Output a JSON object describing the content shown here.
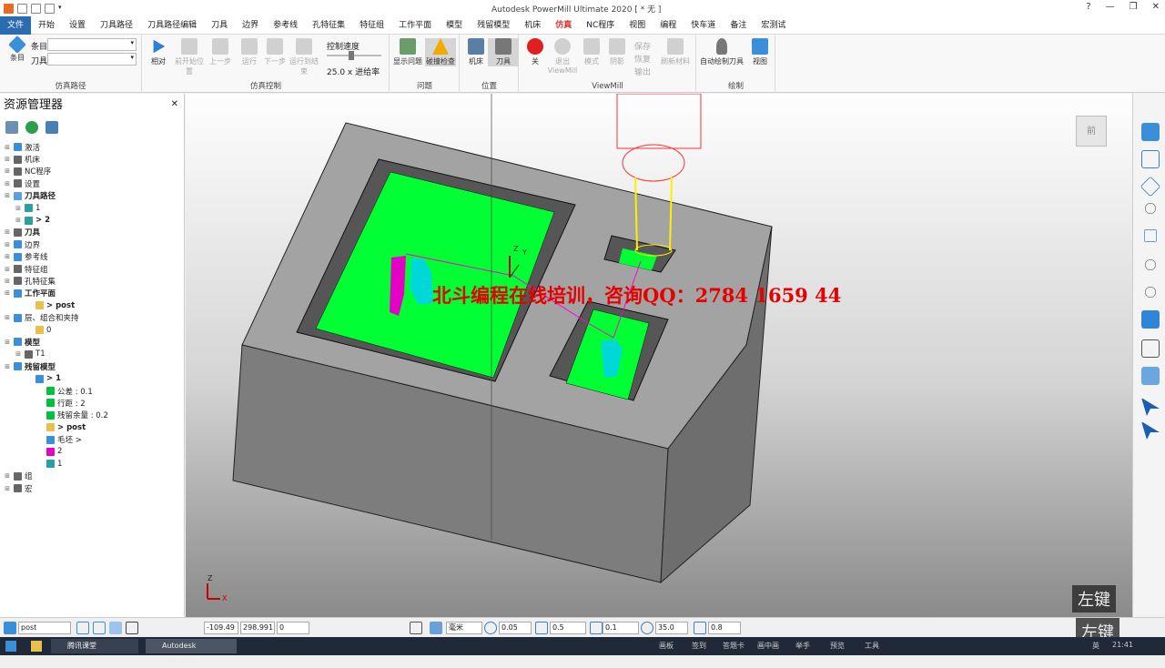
{
  "titlebar": {
    "title": "Autodesk PowerMill Ultimate 2020   [ * 无 ]",
    "help_icon": "help-icon"
  },
  "ribbon_tabs": [
    "文件",
    "开始",
    "设置",
    "刀具路径",
    "刀具路径编辑",
    "刀具",
    "边界",
    "参考线",
    "孔特征集",
    "特征组",
    "工作平面",
    "模型",
    "残留模型",
    "机床",
    "仿真",
    "NC程序",
    "视图",
    "编程",
    "快车道",
    "备注",
    "宏测试"
  ],
  "ribbon": {
    "toolpath_group": {
      "label": "仿真路径",
      "big_button": "条目",
      "item_label": "条目",
      "tool_label": "刀具"
    },
    "sim_control": {
      "label": "仿真控制",
      "buttons": [
        "相对",
        "前开始位置",
        "上一步",
        "运行",
        "下一步",
        "运行到结束"
      ],
      "speed_label": "控制速度",
      "speed_value": "25.0 x 进给率"
    },
    "issues": {
      "label": "问题",
      "buttons": [
        "显示问题",
        "碰撞检查"
      ]
    },
    "position": {
      "label": "位置",
      "buttons": [
        "机床",
        "刀具"
      ]
    },
    "viewmill": {
      "label": "ViewMill",
      "buttons": [
        "关",
        "退出 ViewMill",
        "模式",
        "阴影"
      ],
      "small": [
        "保存",
        "恢复",
        "输出",
        "刷新材料"
      ]
    },
    "draw": {
      "label": "绘制",
      "buttons": [
        "自动绘制刀具",
        "视图"
      ]
    }
  },
  "explorer": {
    "title": "资源管理器",
    "items": [
      {
        "label": "激活",
        "level": 0,
        "bold": false
      },
      {
        "label": "机床",
        "level": 0,
        "bold": false
      },
      {
        "label": "NC程序",
        "level": 0,
        "bold": false
      },
      {
        "label": "设置",
        "level": 0,
        "bold": false
      },
      {
        "label": "刀具路径",
        "level": 0,
        "bold": true
      },
      {
        "label": "1",
        "level": 1,
        "bold": false
      },
      {
        "label": "> 2",
        "level": 1,
        "bold": true
      },
      {
        "label": "刀具",
        "level": 0,
        "bold": true
      },
      {
        "label": "边界",
        "level": 0,
        "bold": false
      },
      {
        "label": "参考线",
        "level": 0,
        "bold": false
      },
      {
        "label": "特征组",
        "level": 0,
        "bold": false
      },
      {
        "label": "孔特征集",
        "level": 0,
        "bold": false
      },
      {
        "label": "工作平面",
        "level": 0,
        "bold": true
      },
      {
        "label": "> post",
        "level": 2,
        "bold": true
      },
      {
        "label": "层、组合和夹持",
        "level": 0,
        "bold": false
      },
      {
        "label": "0",
        "level": 2,
        "bold": false
      },
      {
        "label": "模型",
        "level": 0,
        "bold": true
      },
      {
        "label": "T1",
        "level": 1,
        "bold": false
      },
      {
        "label": "残留模型",
        "level": 0,
        "bold": true
      },
      {
        "label": "> 1",
        "level": 2,
        "bold": true
      },
      {
        "label": "公差 : 0.1",
        "level": 3,
        "bold": false
      },
      {
        "label": "行距 : 2",
        "level": 3,
        "bold": false
      },
      {
        "label": "残留余量 : 0.2",
        "level": 3,
        "bold": false
      },
      {
        "label": "> post",
        "level": 3,
        "bold": true
      },
      {
        "label": "毛坯 >",
        "level": 3,
        "bold": false
      },
      {
        "label": "2",
        "level": 3,
        "bold": false
      },
      {
        "label": "1",
        "level": 3,
        "bold": false
      },
      {
        "label": "组",
        "level": 0,
        "bold": false
      },
      {
        "label": "宏",
        "level": 0,
        "bold": false
      }
    ]
  },
  "viewport": {
    "watermark": "北斗编程在线培训，咨询QQ：2784 1659 44",
    "viewcube_label": "前",
    "key_hint_1": "左键",
    "key_hint_2": "左键",
    "triad_z": "Z",
    "triad_x": "X",
    "triad_y": "Y",
    "colors": {
      "machined": "#00ff33",
      "stock": "#8a8a8a",
      "stock_top": "#a5a5a5",
      "tool": "#ff3333",
      "holder": "#ffee00",
      "residual": "#00d8d8",
      "path": "#ff00cc"
    }
  },
  "status": {
    "workplane": "post",
    "x": "-109.49",
    "y": "298.991",
    "z": "0",
    "units": "毫米",
    "tolerance": "0.05",
    "thickness": "0.5",
    "rapid": "0.1",
    "angle": "35.0",
    "stepover": "0.8"
  },
  "taskbar": {
    "apps": [
      "腾讯课堂",
      "Autodesk PowerMill..."
    ],
    "tray_items": [
      "画板",
      "签到",
      "答题卡",
      "画中画",
      "举手",
      "预览",
      "工具"
    ],
    "ime": "英",
    "time": "21:41"
  }
}
